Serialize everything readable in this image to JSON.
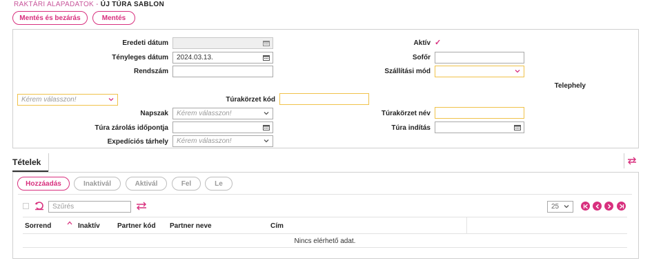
{
  "breadcrumb": {
    "section": "RAKTÁRI ALAPADATOK -",
    "page": "ÚJ TÚRA SABLON"
  },
  "toolbar": {
    "save_close": "Mentés és bezárás",
    "save": "Mentés"
  },
  "form": {
    "original_date": {
      "label": "Eredeti dátum",
      "value": ""
    },
    "actual_date": {
      "label": "Tényleges dátum",
      "value": "2024.03.13."
    },
    "plate": {
      "label": "Rendszám",
      "value": ""
    },
    "active": {
      "label": "Aktív",
      "checked": "✓"
    },
    "driver": {
      "label": "Sofőr",
      "value": ""
    },
    "shipping_mode": {
      "label": "Szállítási mód",
      "value": ""
    },
    "site": {
      "label": "Telephely",
      "placeholder": "Kérem válasszon!"
    },
    "zone_code": {
      "label": "Túrakörzet kód",
      "value": ""
    },
    "time_slot": {
      "label": "Napszak",
      "placeholder": "Kérem válasszon!"
    },
    "zone_name": {
      "label": "Túrakörzet név",
      "value": ""
    },
    "lock_time": {
      "label": "Túra zárolás időpontja",
      "value": ""
    },
    "start": {
      "label": "Túra indítás",
      "value": ""
    },
    "expedition_storage": {
      "label": "Expedíciós tárhely",
      "placeholder": "Kérem válasszon!"
    }
  },
  "items_tab": {
    "label": "Tételek"
  },
  "items_toolbar": {
    "add": "Hozzáadás",
    "deactivate": "Inaktivál",
    "activate": "Aktivál",
    "up": "Fel",
    "down": "Le"
  },
  "grid": {
    "filter_placeholder": "Szűrés",
    "page_size": "25",
    "columns": [
      "Sorrend",
      "Inaktív",
      "Partner kód",
      "Partner neve",
      "Cím"
    ],
    "empty_message": "Nincs elérhető adat."
  },
  "colors": {
    "accent": "#d8307e",
    "breadcrumb": "#c8559a",
    "required_border": "#f0c24a"
  }
}
